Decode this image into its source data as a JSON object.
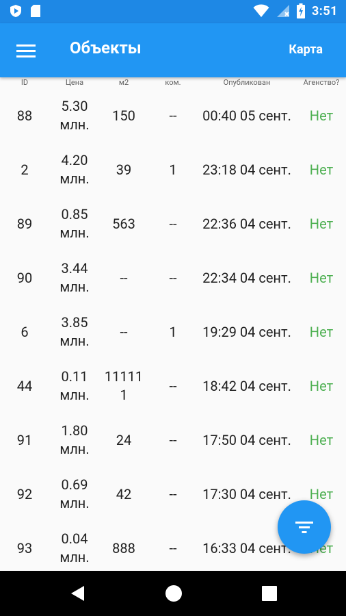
{
  "status_bar": {
    "time": "3:51",
    "icons": [
      "play-store-icon",
      "sd-card-icon",
      "wifi-icon",
      "no-signal-icon",
      "battery-charging-icon"
    ]
  },
  "app_bar": {
    "menu_icon": "hamburger-menu-icon",
    "title": "Объекты",
    "action_label": "Карта"
  },
  "table": {
    "headers": {
      "id": "ID",
      "price": "Цена",
      "area": "м2",
      "rooms": "ком.",
      "published": "Опубликован",
      "agency": "Агенство?"
    },
    "rows": [
      {
        "id": "88",
        "price": "5.30 млн.",
        "area": "150",
        "rooms": "--",
        "published": "00:40 05 сент.",
        "agency": "Нет"
      },
      {
        "id": "2",
        "price": "4.20 млн.",
        "area": "39",
        "rooms": "1",
        "published": "23:18 04 сент.",
        "agency": "Нет"
      },
      {
        "id": "89",
        "price": "0.85 млн.",
        "area": "563",
        "rooms": "--",
        "published": "22:36 04 сент.",
        "agency": "Нет"
      },
      {
        "id": "90",
        "price": "3.44 млн.",
        "area": "--",
        "rooms": "--",
        "published": "22:34 04 сент.",
        "agency": "Нет"
      },
      {
        "id": "6",
        "price": "3.85 млн.",
        "area": "--",
        "rooms": "1",
        "published": "19:29 04 сент.",
        "agency": "Нет"
      },
      {
        "id": "44",
        "price": "0.11 млн.",
        "area": "111111",
        "rooms": "--",
        "published": "18:42 04 сент.",
        "agency": "Нет"
      },
      {
        "id": "91",
        "price": "1.80 млн.",
        "area": "24",
        "rooms": "--",
        "published": "17:50 04 сент.",
        "agency": "Нет"
      },
      {
        "id": "92",
        "price": "0.69 млн.",
        "area": "42",
        "rooms": "--",
        "published": "17:30 04 сент.",
        "agency": "Нет"
      },
      {
        "id": "93",
        "price": "0.04 млн.",
        "area": "888",
        "rooms": "--",
        "published": "16:33 04 сент.",
        "agency": "Нет"
      }
    ]
  },
  "fab": {
    "icon": "filter-icon"
  },
  "nav_bar": {
    "icons": [
      "back-icon",
      "home-icon",
      "recents-icon"
    ]
  },
  "colors": {
    "primary": "#2196f3",
    "status_bar": "#1e88e5",
    "agency_text": "#4caf50"
  }
}
